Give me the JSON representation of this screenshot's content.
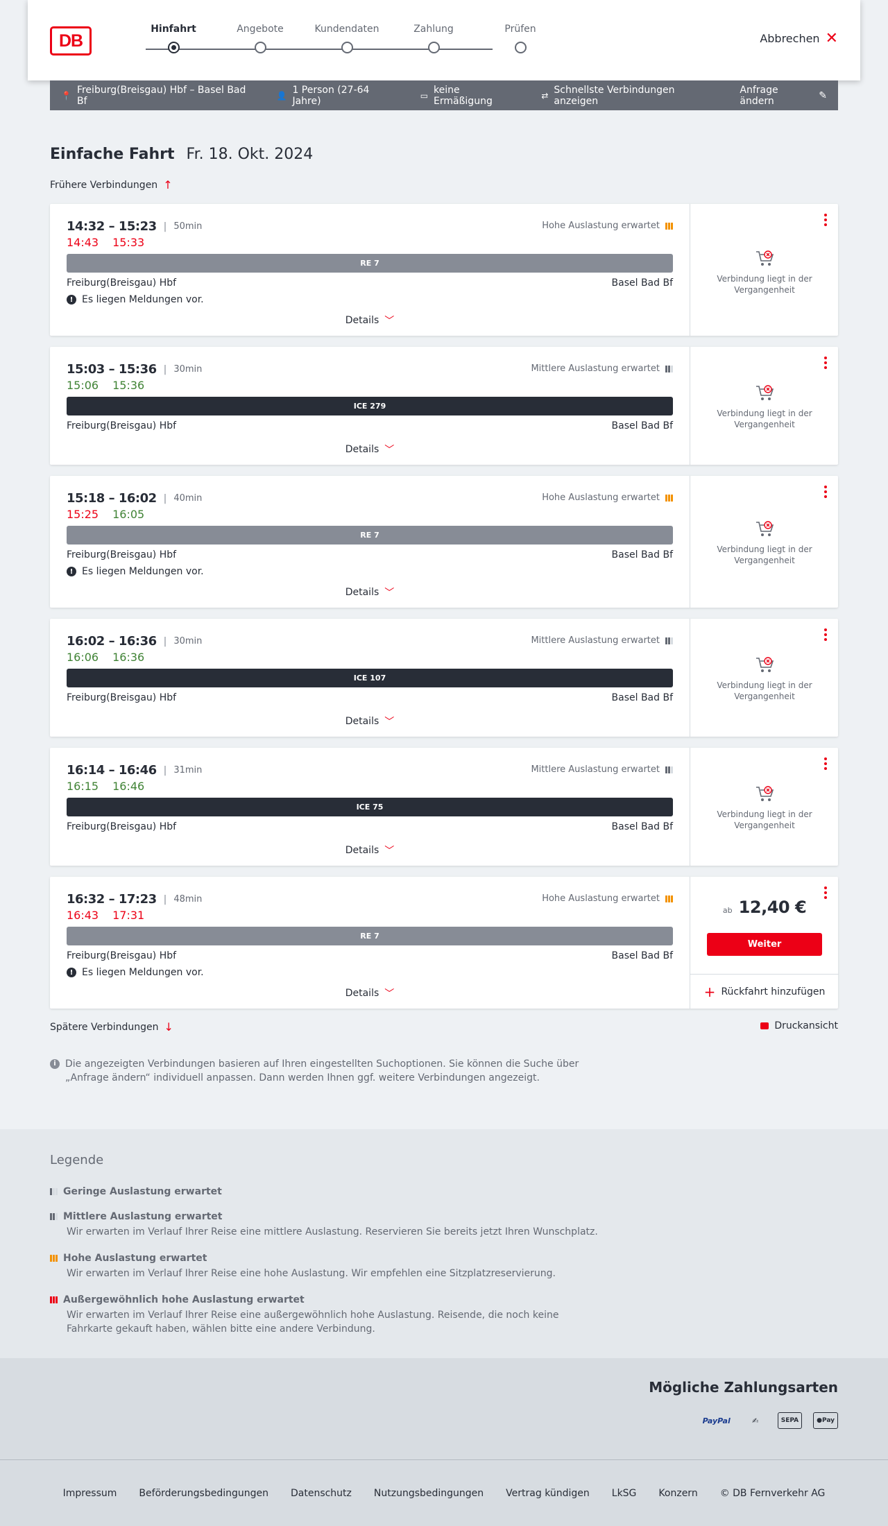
{
  "header": {
    "logo": "DB",
    "steps": [
      {
        "label": "Hinfahrt",
        "active": true
      },
      {
        "label": "Angebote",
        "active": false
      },
      {
        "label": "Kundendaten",
        "active": false
      },
      {
        "label": "Zahlung",
        "active": false
      },
      {
        "label": "Prüfen",
        "active": false
      }
    ],
    "cancel_label": "Abbrechen"
  },
  "query": {
    "route": "Freiburg(Breisgau) Hbf – Basel Bad Bf",
    "passengers": "1 Person (27-64 Jahre)",
    "discount": "keine Ermäßigung",
    "fastest": "Schnellste Verbindungen anzeigen",
    "edit_label": "Anfrage ändern"
  },
  "title": {
    "type": "Einfache Fahrt",
    "date": "Fr. 18. Okt. 2024"
  },
  "earlier_label": "Frühere Verbindungen",
  "later_label": "Spätere Verbindungen",
  "print_label": "Druckansicht",
  "connections": [
    {
      "times": "14:32 – 15:23",
      "duration": "50min",
      "rt_dep": "14:43",
      "rt_arr": "15:33",
      "rt_dep_status": "late",
      "rt_arr_status": "late",
      "load": "Hohe Auslastung erwartet",
      "load_level": "high",
      "train": "RE 7",
      "train_type": "re",
      "from": "Freiburg(Breisgau) Hbf",
      "to": "Basel Bad Bf",
      "message": "Es liegen Meldungen vor.",
      "details": "Details",
      "past": "Verbindung liegt in der Vergangenheit"
    },
    {
      "times": "15:03 – 15:36",
      "duration": "30min",
      "rt_dep": "15:06",
      "rt_arr": "15:36",
      "rt_dep_status": "ontime",
      "rt_arr_status": "ontime",
      "load": "Mittlere Auslastung erwartet",
      "load_level": "mid",
      "train": "ICE 279",
      "train_type": "ice",
      "from": "Freiburg(Breisgau) Hbf",
      "to": "Basel Bad Bf",
      "message": "",
      "details": "Details",
      "past": "Verbindung liegt in der Vergangenheit"
    },
    {
      "times": "15:18 – 16:02",
      "duration": "40min",
      "rt_dep": "15:25",
      "rt_arr": "16:05",
      "rt_dep_status": "late",
      "rt_arr_status": "ontime",
      "load": "Hohe Auslastung erwartet",
      "load_level": "high",
      "train": "RE 7",
      "train_type": "re",
      "from": "Freiburg(Breisgau) Hbf",
      "to": "Basel Bad Bf",
      "message": "Es liegen Meldungen vor.",
      "details": "Details",
      "past": "Verbindung liegt in der Vergangenheit"
    },
    {
      "times": "16:02 – 16:36",
      "duration": "30min",
      "rt_dep": "16:06",
      "rt_arr": "16:36",
      "rt_dep_status": "ontime",
      "rt_arr_status": "ontime",
      "load": "Mittlere Auslastung erwartet",
      "load_level": "mid",
      "train": "ICE 107",
      "train_type": "ice",
      "from": "Freiburg(Breisgau) Hbf",
      "to": "Basel Bad Bf",
      "message": "",
      "details": "Details",
      "past": "Verbindung liegt in der Vergangenheit"
    },
    {
      "times": "16:14 – 16:46",
      "duration": "31min",
      "rt_dep": "16:15",
      "rt_arr": "16:46",
      "rt_dep_status": "ontime",
      "rt_arr_status": "ontime",
      "load": "Mittlere Auslastung erwartet",
      "load_level": "mid",
      "train": "ICE 75",
      "train_type": "ice",
      "from": "Freiburg(Breisgau) Hbf",
      "to": "Basel Bad Bf",
      "message": "",
      "details": "Details",
      "past": "Verbindung liegt in der Vergangenheit"
    },
    {
      "times": "16:32 – 17:23",
      "duration": "48min",
      "rt_dep": "16:43",
      "rt_arr": "17:31",
      "rt_dep_status": "late",
      "rt_arr_status": "late",
      "load": "Hohe Auslastung erwartet",
      "load_level": "high",
      "train": "RE 7",
      "train_type": "re",
      "from": "Freiburg(Breisgau) Hbf",
      "to": "Basel Bad Bf",
      "message": "Es liegen Meldungen vor.",
      "details": "Details",
      "price_prefix": "ab",
      "price": "12,40 €",
      "cta": "Weiter",
      "return_label": "Rückfahrt hinzufügen"
    }
  ],
  "info_text": "Die angezeigten Verbindungen basieren auf Ihren eingestellten Suchoptionen. Sie können die Suche über „Anfrage ändern“ individuell anpassen. Dann werden Ihnen ggf. weitere Verbindungen angezeigt.",
  "legend": {
    "title": "Legende",
    "items": [
      {
        "title": "Geringe Auslastung erwartet",
        "desc": ""
      },
      {
        "title": "Mittlere Auslastung erwartet",
        "desc": "Wir erwarten im Verlauf Ihrer Reise eine mittlere Auslastung. Reservieren Sie bereits jetzt Ihren Wunschplatz."
      },
      {
        "title": "Hohe Auslastung erwartet",
        "desc": "Wir erwarten im Verlauf Ihrer Reise eine hohe Auslastung. Wir empfehlen eine Sitzplatzreservierung."
      },
      {
        "title": "Außergewöhnlich hohe Auslastung erwartet",
        "desc": "Wir erwarten im Verlauf Ihrer Reise eine außergewöhnlich hohe Auslastung. Reisende, die noch keine Fahrkarte gekauft haben, wählen bitte eine andere Verbindung."
      }
    ]
  },
  "payment": {
    "title": "Mögliche Zahlungsarten",
    "methods": [
      "PayPal",
      "SEPA",
      "Pay"
    ]
  },
  "footer": {
    "links": [
      "Impressum",
      "Beförderungsbedingungen",
      "Datenschutz",
      "Nutzungsbedingungen",
      "Vertrag kündigen",
      "LkSG",
      "Konzern",
      "© DB Fernverkehr AG"
    ]
  },
  "colors": {
    "brand": "#ec0016",
    "late": "#ec0016",
    "ontime": "#408335",
    "high_load": "#f39200"
  }
}
